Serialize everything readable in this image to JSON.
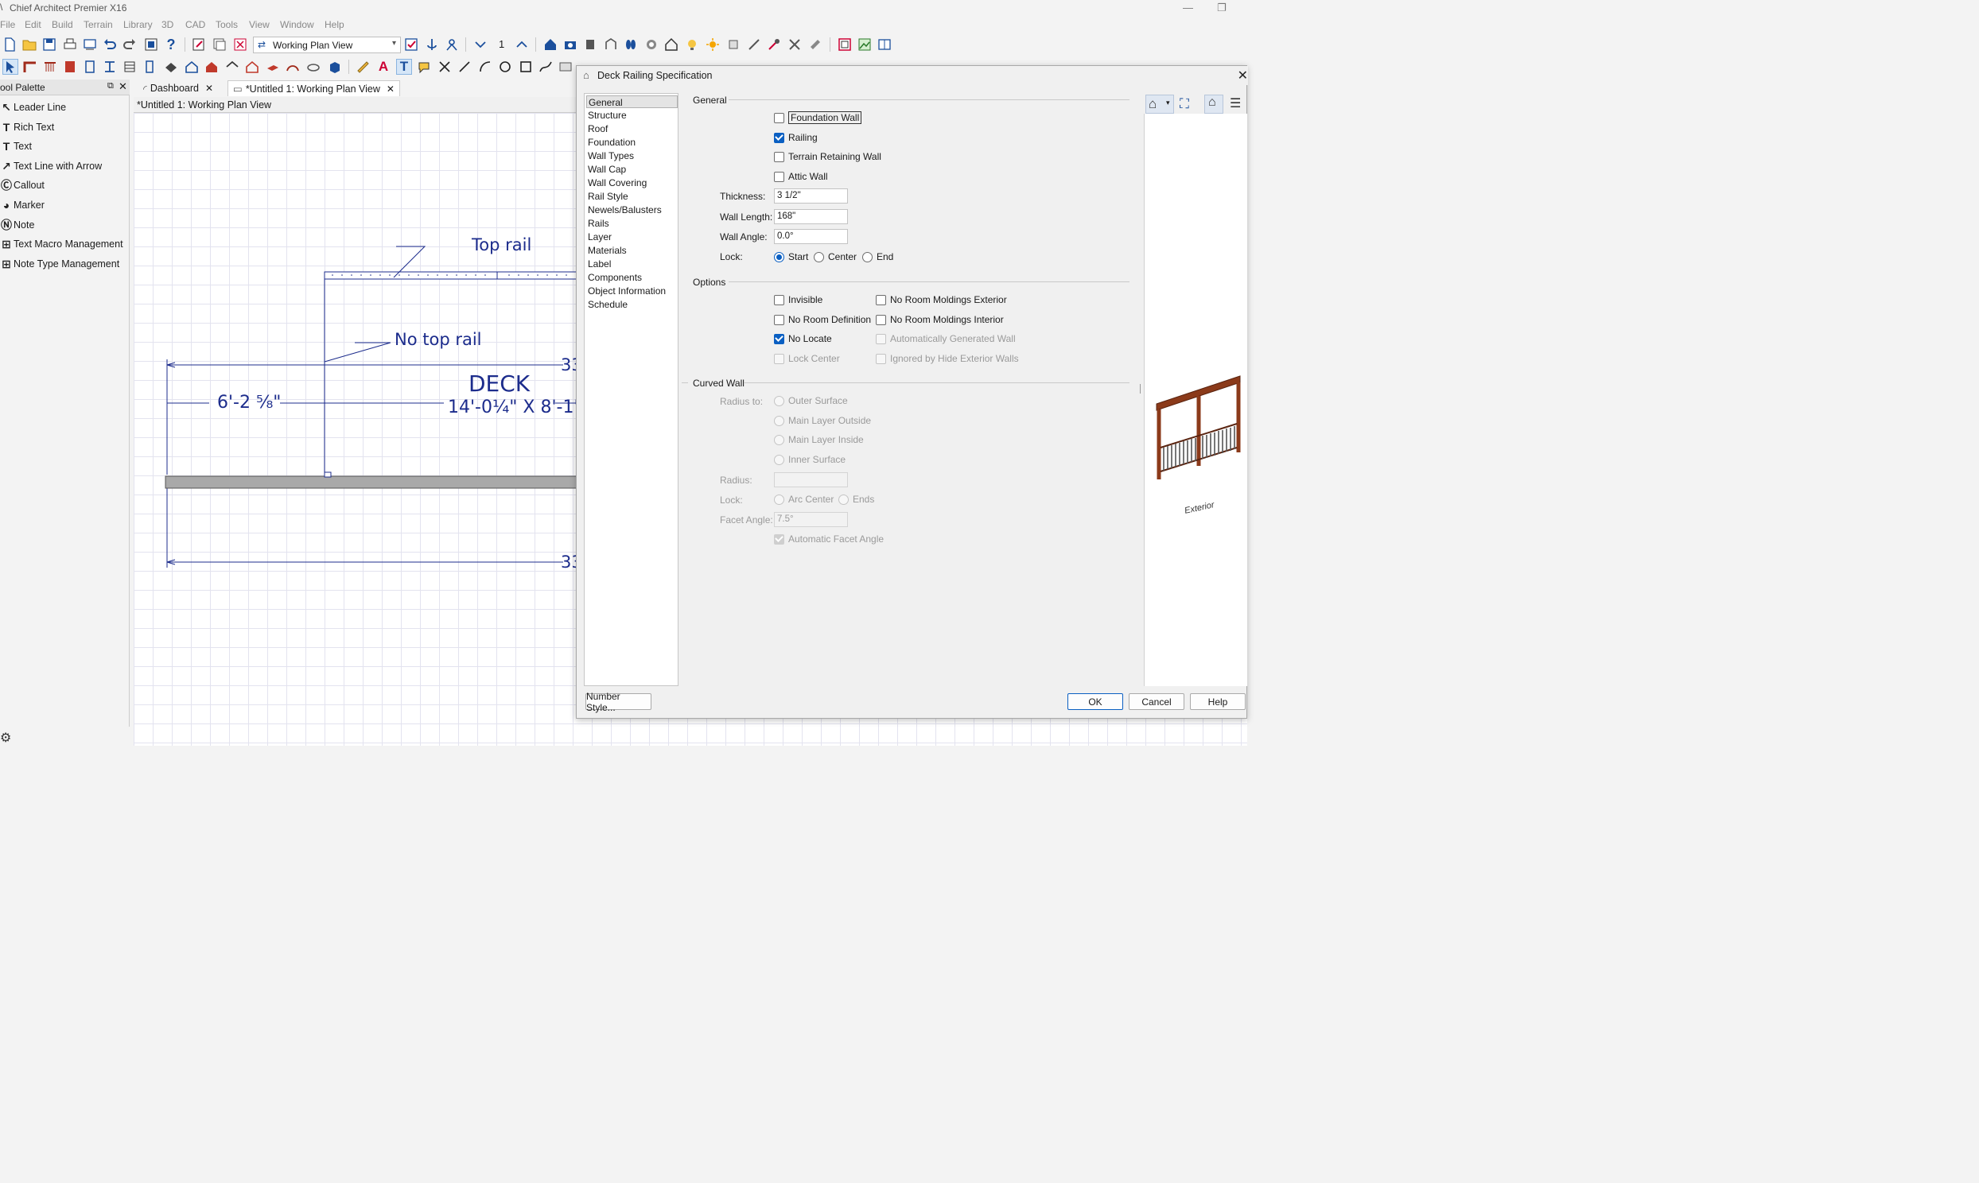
{
  "app": {
    "title": "Chief Architect Premier X16"
  },
  "menu": [
    "File",
    "Edit",
    "Build",
    "Terrain",
    "Library",
    "3D",
    "CAD",
    "Tools",
    "View",
    "Window",
    "Help"
  ],
  "toolbar": {
    "view_select": "Working Plan View",
    "floor_number": "1"
  },
  "palette": {
    "title": "ool Palette",
    "items": [
      {
        "label": "Leader Line",
        "icon": "leader-line-icon",
        "glyph": "↖"
      },
      {
        "label": "Rich Text",
        "icon": "rich-text-icon",
        "glyph": "T"
      },
      {
        "label": "Text",
        "icon": "text-icon",
        "glyph": "T"
      },
      {
        "label": "Text Line with Arrow",
        "icon": "text-arrow-icon",
        "glyph": "↗"
      },
      {
        "label": "Callout",
        "icon": "callout-icon",
        "glyph": "Ⓒ"
      },
      {
        "label": "Marker",
        "icon": "marker-icon",
        "glyph": "◕"
      },
      {
        "label": "Note",
        "icon": "note-icon",
        "glyph": "Ⓝ"
      },
      {
        "label": "Text Macro Management",
        "icon": "text-macro-icon",
        "glyph": "⊞"
      },
      {
        "label": "Note Type Management",
        "icon": "note-type-icon",
        "glyph": "⊞"
      }
    ]
  },
  "tabs": [
    {
      "label": "Dashboard"
    },
    {
      "label": "*Untitled 1:  Working Plan View"
    }
  ],
  "canvas": {
    "header": "*Untitled 1:  Working Plan View",
    "labels": {
      "top_rail": "Top rail",
      "no_top_rail": "No top rail",
      "deck": "DECK",
      "deck_size": "14'-0¼\" X 8'-1\"",
      "dim_left": "6'-2 ⁵⁄₈\"",
      "dim_top_partial": "33",
      "dim_bottom_partial": "33"
    }
  },
  "dialog": {
    "title": "Deck Railing Specification",
    "nav": [
      "General",
      "Structure",
      "Roof",
      "Foundation",
      "Wall Types",
      "Wall Cap",
      "Wall Covering",
      "Rail Style",
      "Newels/Balusters",
      "Rails",
      "Layer",
      "Materials",
      "Label",
      "Components",
      "Object Information",
      "Schedule"
    ],
    "general": {
      "label": "General",
      "foundation_wall": "Foundation Wall",
      "railing": "Railing",
      "terrain_retaining_wall": "Terrain Retaining Wall",
      "attic_wall": "Attic Wall",
      "thickness_label": "Thickness:",
      "thickness_value": "3 1/2\"",
      "wall_length_label": "Wall Length:",
      "wall_length_value": "168\"",
      "wall_angle_label": "Wall Angle:",
      "wall_angle_value": "0.0°",
      "lock_label": "Lock:",
      "lock_start": "Start",
      "lock_center": "Center",
      "lock_end": "End"
    },
    "options": {
      "label": "Options",
      "invisible": "Invisible",
      "no_room_definition": "No Room Definition",
      "no_locate": "No Locate",
      "lock_center": "Lock Center",
      "no_room_moldings_exterior": "No Room Moldings Exterior",
      "no_room_moldings_interior": "No Room Moldings Interior",
      "auto_generated_wall": "Automatically Generated Wall",
      "ignored_by_hide": "Ignored by Hide Exterior Walls"
    },
    "curved": {
      "label": "Curved Wall",
      "radius_to": "Radius to:",
      "outer_surface": "Outer Surface",
      "main_layer_outside": "Main Layer Outside",
      "main_layer_inside": "Main Layer Inside",
      "inner_surface": "Inner Surface",
      "radius_label": "Radius:",
      "radius_value": "",
      "lock_label": "Lock:",
      "arc_center": "Arc Center",
      "ends": "Ends",
      "facet_angle_label": "Facet Angle:",
      "facet_angle_value": "7.5°",
      "automatic_facet_angle": "Automatic Facet Angle"
    },
    "buttons": {
      "number_style": "Number Style...",
      "ok": "OK",
      "cancel": "Cancel",
      "help": "Help"
    },
    "preview_caption": "Exterior"
  }
}
